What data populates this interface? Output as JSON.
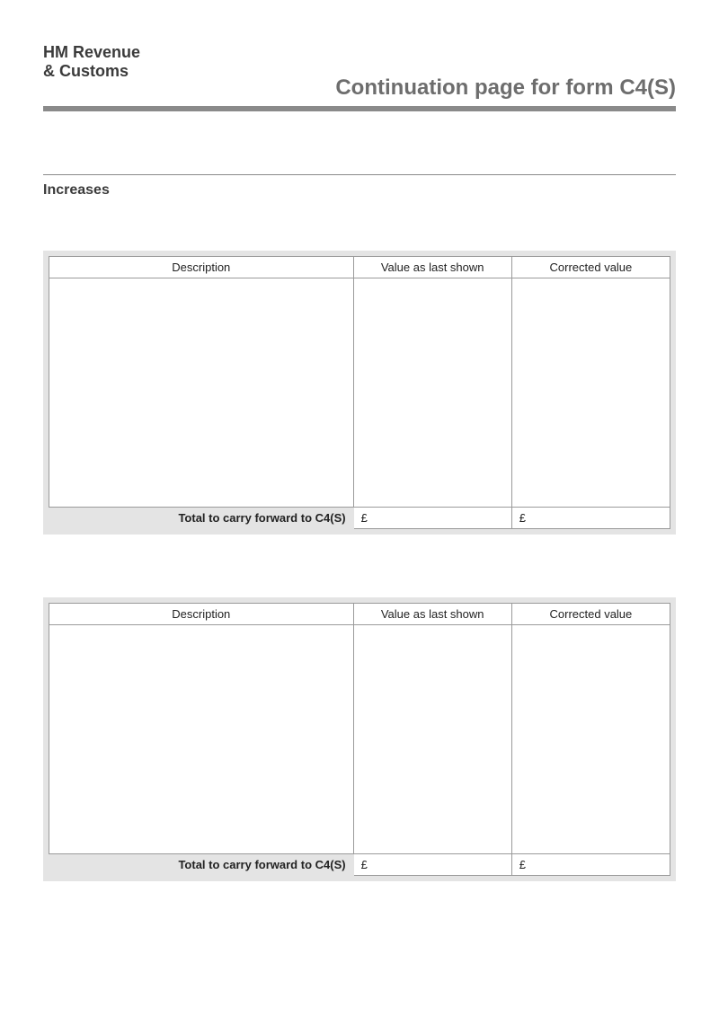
{
  "header": {
    "logo_line1": "HM Revenue",
    "logo_line2": "& Customs",
    "title": "Continuation page for form C4(S)"
  },
  "section": {
    "heading": "Increases"
  },
  "columns": {
    "description": "Description",
    "value_last": "Value as last shown",
    "value_corrected": "Corrected value"
  },
  "totals": {
    "label": "Total to carry forward to C4(S)",
    "currency": "£"
  },
  "tables": {
    "t1": {
      "last": "",
      "corrected": ""
    },
    "t2": {
      "last": "",
      "corrected": ""
    }
  }
}
